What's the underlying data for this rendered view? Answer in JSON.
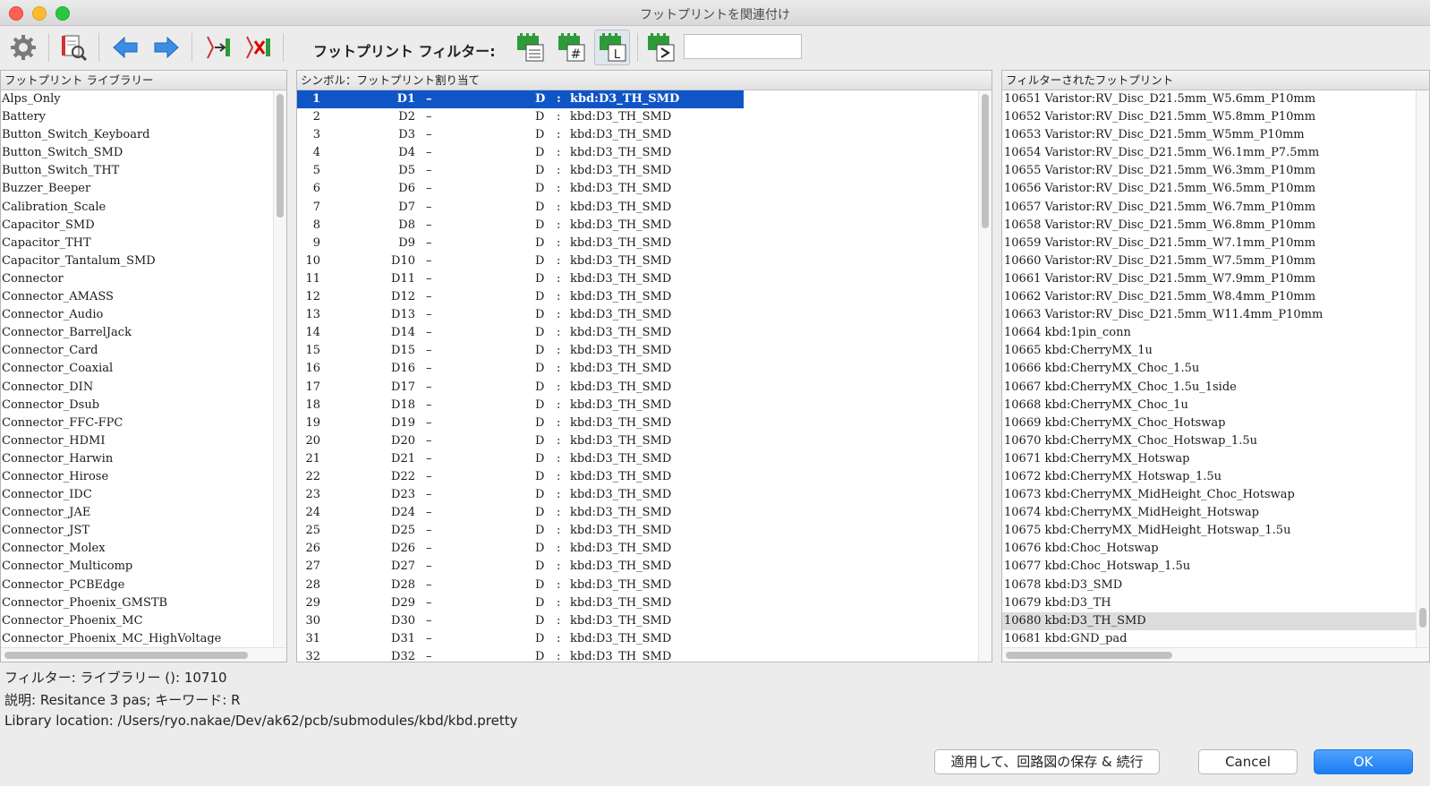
{
  "window": {
    "title": "フットプリントを関連付け"
  },
  "toolbar": {
    "filter_label": "フットプリント フィルター:",
    "filter_value": ""
  },
  "libraries_panel": {
    "header": "フットプリント ライブラリー",
    "items": [
      "Alps_Only",
      "Battery",
      "Button_Switch_Keyboard",
      "Button_Switch_SMD",
      "Button_Switch_THT",
      "Buzzer_Beeper",
      "Calibration_Scale",
      "Capacitor_SMD",
      "Capacitor_THT",
      "Capacitor_Tantalum_SMD",
      "Connector",
      "Connector_AMASS",
      "Connector_Audio",
      "Connector_BarrelJack",
      "Connector_Card",
      "Connector_Coaxial",
      "Connector_DIN",
      "Connector_Dsub",
      "Connector_FFC-FPC",
      "Connector_HDMI",
      "Connector_Harwin",
      "Connector_Hirose",
      "Connector_IDC",
      "Connector_JAE",
      "Connector_JST",
      "Connector_Molex",
      "Connector_Multicomp",
      "Connector_PCBEdge",
      "Connector_Phoenix_GMSTB",
      "Connector_Phoenix_MC",
      "Connector_Phoenix_MC_HighVoltage"
    ]
  },
  "symbols_panel": {
    "header": "シンボル：フットプリント割り当て",
    "rows": [
      {
        "num": "1",
        "ref": "D1",
        "dash": "–",
        "val": "D",
        "colon": ":",
        "fp": "kbd:D3_TH_SMD"
      },
      {
        "num": "2",
        "ref": "D2",
        "dash": "–",
        "val": "D",
        "colon": ":",
        "fp": "kbd:D3_TH_SMD"
      },
      {
        "num": "3",
        "ref": "D3",
        "dash": "–",
        "val": "D",
        "colon": ":",
        "fp": "kbd:D3_TH_SMD"
      },
      {
        "num": "4",
        "ref": "D4",
        "dash": "–",
        "val": "D",
        "colon": ":",
        "fp": "kbd:D3_TH_SMD"
      },
      {
        "num": "5",
        "ref": "D5",
        "dash": "–",
        "val": "D",
        "colon": ":",
        "fp": "kbd:D3_TH_SMD"
      },
      {
        "num": "6",
        "ref": "D6",
        "dash": "–",
        "val": "D",
        "colon": ":",
        "fp": "kbd:D3_TH_SMD"
      },
      {
        "num": "7",
        "ref": "D7",
        "dash": "–",
        "val": "D",
        "colon": ":",
        "fp": "kbd:D3_TH_SMD"
      },
      {
        "num": "8",
        "ref": "D8",
        "dash": "–",
        "val": "D",
        "colon": ":",
        "fp": "kbd:D3_TH_SMD"
      },
      {
        "num": "9",
        "ref": "D9",
        "dash": "–",
        "val": "D",
        "colon": ":",
        "fp": "kbd:D3_TH_SMD"
      },
      {
        "num": "10",
        "ref": "D10",
        "dash": "–",
        "val": "D",
        "colon": ":",
        "fp": "kbd:D3_TH_SMD"
      },
      {
        "num": "11",
        "ref": "D11",
        "dash": "–",
        "val": "D",
        "colon": ":",
        "fp": "kbd:D3_TH_SMD"
      },
      {
        "num": "12",
        "ref": "D12",
        "dash": "–",
        "val": "D",
        "colon": ":",
        "fp": "kbd:D3_TH_SMD"
      },
      {
        "num": "13",
        "ref": "D13",
        "dash": "–",
        "val": "D",
        "colon": ":",
        "fp": "kbd:D3_TH_SMD"
      },
      {
        "num": "14",
        "ref": "D14",
        "dash": "–",
        "val": "D",
        "colon": ":",
        "fp": "kbd:D3_TH_SMD"
      },
      {
        "num": "15",
        "ref": "D15",
        "dash": "–",
        "val": "D",
        "colon": ":",
        "fp": "kbd:D3_TH_SMD"
      },
      {
        "num": "16",
        "ref": "D16",
        "dash": "–",
        "val": "D",
        "colon": ":",
        "fp": "kbd:D3_TH_SMD"
      },
      {
        "num": "17",
        "ref": "D17",
        "dash": "–",
        "val": "D",
        "colon": ":",
        "fp": "kbd:D3_TH_SMD"
      },
      {
        "num": "18",
        "ref": "D18",
        "dash": "–",
        "val": "D",
        "colon": ":",
        "fp": "kbd:D3_TH_SMD"
      },
      {
        "num": "19",
        "ref": "D19",
        "dash": "–",
        "val": "D",
        "colon": ":",
        "fp": "kbd:D3_TH_SMD"
      },
      {
        "num": "20",
        "ref": "D20",
        "dash": "–",
        "val": "D",
        "colon": ":",
        "fp": "kbd:D3_TH_SMD"
      },
      {
        "num": "21",
        "ref": "D21",
        "dash": "–",
        "val": "D",
        "colon": ":",
        "fp": "kbd:D3_TH_SMD"
      },
      {
        "num": "22",
        "ref": "D22",
        "dash": "–",
        "val": "D",
        "colon": ":",
        "fp": "kbd:D3_TH_SMD"
      },
      {
        "num": "23",
        "ref": "D23",
        "dash": "–",
        "val": "D",
        "colon": ":",
        "fp": "kbd:D3_TH_SMD"
      },
      {
        "num": "24",
        "ref": "D24",
        "dash": "–",
        "val": "D",
        "colon": ":",
        "fp": "kbd:D3_TH_SMD"
      },
      {
        "num": "25",
        "ref": "D25",
        "dash": "–",
        "val": "D",
        "colon": ":",
        "fp": "kbd:D3_TH_SMD"
      },
      {
        "num": "26",
        "ref": "D26",
        "dash": "–",
        "val": "D",
        "colon": ":",
        "fp": "kbd:D3_TH_SMD"
      },
      {
        "num": "27",
        "ref": "D27",
        "dash": "–",
        "val": "D",
        "colon": ":",
        "fp": "kbd:D3_TH_SMD"
      },
      {
        "num": "28",
        "ref": "D28",
        "dash": "–",
        "val": "D",
        "colon": ":",
        "fp": "kbd:D3_TH_SMD"
      },
      {
        "num": "29",
        "ref": "D29",
        "dash": "–",
        "val": "D",
        "colon": ":",
        "fp": "kbd:D3_TH_SMD"
      },
      {
        "num": "30",
        "ref": "D30",
        "dash": "–",
        "val": "D",
        "colon": ":",
        "fp": "kbd:D3_TH_SMD"
      },
      {
        "num": "31",
        "ref": "D31",
        "dash": "–",
        "val": "D",
        "colon": ":",
        "fp": "kbd:D3_TH_SMD"
      },
      {
        "num": "32",
        "ref": "D32",
        "dash": "–",
        "val": "D",
        "colon": ":",
        "fp": "kbd:D3_TH_SMD"
      }
    ]
  },
  "filtered_panel": {
    "header": "フィルターされたフットプリント",
    "items": [
      "10651 Varistor:RV_Disc_D21.5mm_W5.6mm_P10mm",
      "10652 Varistor:RV_Disc_D21.5mm_W5.8mm_P10mm",
      "10653 Varistor:RV_Disc_D21.5mm_W5mm_P10mm",
      "10654 Varistor:RV_Disc_D21.5mm_W6.1mm_P7.5mm",
      "10655 Varistor:RV_Disc_D21.5mm_W6.3mm_P10mm",
      "10656 Varistor:RV_Disc_D21.5mm_W6.5mm_P10mm",
      "10657 Varistor:RV_Disc_D21.5mm_W6.7mm_P10mm",
      "10658 Varistor:RV_Disc_D21.5mm_W6.8mm_P10mm",
      "10659 Varistor:RV_Disc_D21.5mm_W7.1mm_P10mm",
      "10660 Varistor:RV_Disc_D21.5mm_W7.5mm_P10mm",
      "10661 Varistor:RV_Disc_D21.5mm_W7.9mm_P10mm",
      "10662 Varistor:RV_Disc_D21.5mm_W8.4mm_P10mm",
      "10663 Varistor:RV_Disc_D21.5mm_W11.4mm_P10mm",
      "10664 kbd:1pin_conn",
      "10665 kbd:CherryMX_1u",
      "10666 kbd:CherryMX_Choc_1.5u",
      "10667 kbd:CherryMX_Choc_1.5u_1side",
      "10668 kbd:CherryMX_Choc_1u",
      "10669 kbd:CherryMX_Choc_Hotswap",
      "10670 kbd:CherryMX_Choc_Hotswap_1.5u",
      "10671 kbd:CherryMX_Hotswap",
      "10672 kbd:CherryMX_Hotswap_1.5u",
      "10673 kbd:CherryMX_MidHeight_Choc_Hotswap",
      "10674 kbd:CherryMX_MidHeight_Hotswap",
      "10675 kbd:CherryMX_MidHeight_Hotswap_1.5u",
      "10676 kbd:Choc_Hotswap",
      "10677 kbd:Choc_Hotswap_1.5u",
      "10678 kbd:D3_SMD",
      "10679 kbd:D3_TH",
      "10680 kbd:D3_TH_SMD",
      "10681 kbd:GND_pad"
    ]
  },
  "info": {
    "filter_line": "フィルター: ライブラリー (): 10710",
    "description_line": "説明: Resitance 3 pas;  キーワード: R",
    "location_line": "Library location: /Users/ryo.nakae/Dev/ak62/pcb/submodules/kbd/kbd.pretty"
  },
  "buttons": {
    "apply_label": "適用して、回路図の保存 & 続行",
    "cancel_label": "Cancel",
    "ok_label": "OK"
  },
  "colors": {
    "selection": "#0f55c6",
    "ok_button": "#1a7df3",
    "arrow": "#3a8ee6",
    "pcb_green": "#2f9a3a"
  }
}
